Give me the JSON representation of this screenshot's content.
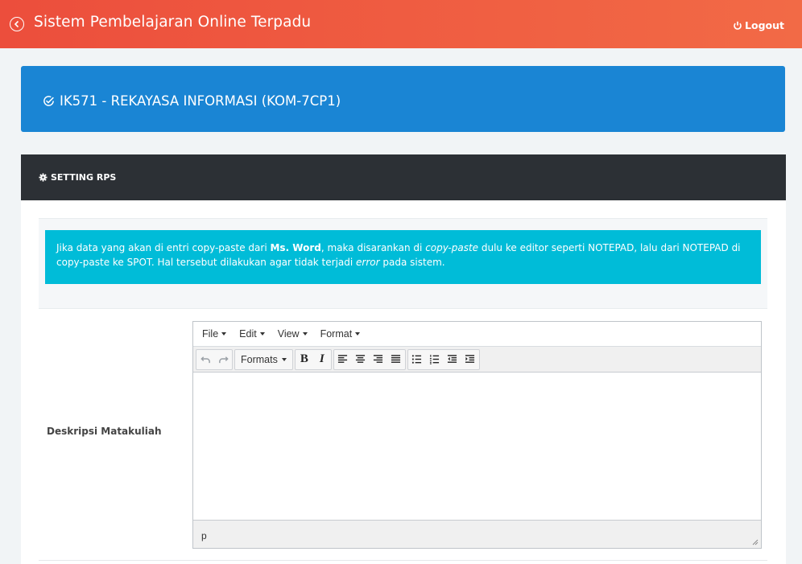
{
  "header": {
    "app_title": "Sistem Pembelajaran Online Terpadu",
    "logout_label": "Logout",
    "gradient_start": "#ec4e3c",
    "gradient_end": "#f26a46"
  },
  "course": {
    "title": "IK571 - REKAYASA INFORMASI (KOM-7CP1)",
    "color": "#1a85d4"
  },
  "panel": {
    "title": "SETTING RPS"
  },
  "notice": {
    "part1": "Jika data yang akan di entri copy-paste dari ",
    "bold1": "Ms. Word",
    "part2": ", maka disarankan di ",
    "italic1": "copy-paste",
    "part3": " dulu ke editor seperti NOTEPAD, lalu dari NOTEPAD di copy-paste ke SPOT. Hal tersebut dilakukan agar tidak terjadi ",
    "italic2": "error",
    "part4": " pada sistem.",
    "color": "#00bcd8"
  },
  "form": {
    "field_label": "Deskripsi Matakuliah",
    "editor": {
      "menus": [
        "File",
        "Edit",
        "View",
        "Format"
      ],
      "formats_label": "Formats",
      "bold_label": "B",
      "italic_label": "I",
      "content": "",
      "status_path": "p"
    }
  },
  "icons": {
    "back": "circle-arrow-left-icon",
    "logout": "power-icon",
    "course": "circle-check-icon",
    "panel": "gear-icon"
  }
}
